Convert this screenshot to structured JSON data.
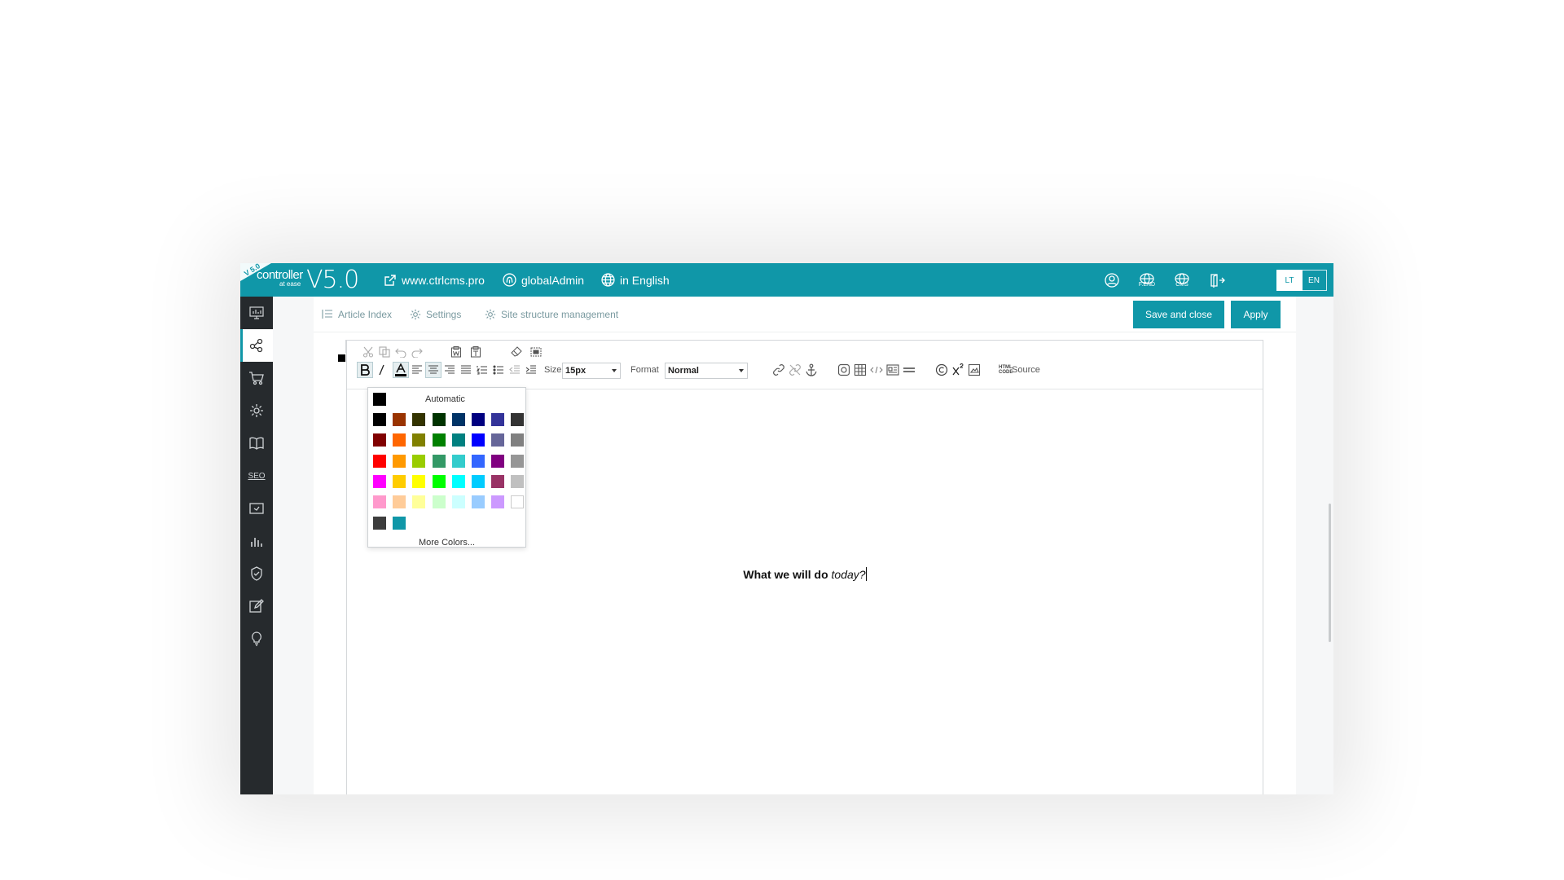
{
  "app": {
    "logo": {
      "corner_version": "V 5.0",
      "brand": "controller",
      "tagline": "at ease",
      "version": "V5.0"
    },
    "topnav": [
      {
        "icon": "external-link-icon",
        "label": "www.ctrlcms.pro"
      },
      {
        "icon": "fingerprint-icon",
        "label": "globalAdmin"
      },
      {
        "icon": "globe-icon",
        "label": "in English"
      }
    ],
    "top_icons": [
      {
        "name": "user-profile-icon",
        "caption": ""
      },
      {
        "name": "frontend-globe-icon",
        "caption": "F.END"
      },
      {
        "name": "cms-globe-icon",
        "caption": "CMS"
      },
      {
        "name": "logout-icon",
        "caption": ""
      }
    ],
    "languages": [
      "LT",
      "EN"
    ],
    "sidebar": [
      {
        "name": "dashboard-icon",
        "label": ""
      },
      {
        "name": "structure-icon",
        "label": ""
      },
      {
        "name": "cart-icon",
        "label": ""
      },
      {
        "name": "settings-gear-icon",
        "label": ""
      },
      {
        "name": "book-icon",
        "label": ""
      },
      {
        "name": "seo-icon",
        "label": "SEO"
      },
      {
        "name": "mail-icon",
        "label": ""
      },
      {
        "name": "statistics-icon",
        "label": ""
      },
      {
        "name": "shield-icon",
        "label": ""
      },
      {
        "name": "edit-icon",
        "label": ""
      },
      {
        "name": "lightbulb-icon",
        "label": ""
      }
    ]
  },
  "subbar": {
    "tabs": [
      "Article Index",
      "Settings",
      "Site structure management"
    ],
    "save_close": "Save and close",
    "apply": "Apply"
  },
  "toolbar": {
    "size_label": "Size",
    "size_value": "15px",
    "format_label": "Format",
    "format_value": "Normal",
    "source_label": "Source",
    "source_icon_text": "HTML CODE"
  },
  "color_picker": {
    "automatic_label": "Automatic",
    "more_label": "More Colors...",
    "palette": [
      [
        "#000000",
        "#993300",
        "#333300",
        "#003300",
        "#003366",
        "#000080",
        "#333399",
        "#333333"
      ],
      [
        "#800000",
        "#ff6600",
        "#808000",
        "#008000",
        "#008080",
        "#0000ff",
        "#666699",
        "#808080"
      ],
      [
        "#ff0000",
        "#ff9900",
        "#99cc00",
        "#339966",
        "#33cccc",
        "#3366ff",
        "#800080",
        "#969696"
      ],
      [
        "#ff00ff",
        "#ffcc00",
        "#ffff00",
        "#00ff00",
        "#00ffff",
        "#00ccff",
        "#993366",
        "#c0c0c0"
      ],
      [
        "#ff99cc",
        "#ffcc99",
        "#ffff99",
        "#ccffcc",
        "#ccffff",
        "#99ccff",
        "#cc99ff",
        "#ffffff"
      ],
      [
        "#3d3d3d",
        "#1097a8"
      ]
    ]
  },
  "document": {
    "text_bold": "What we will do ",
    "text_italic": "today?"
  },
  "colors": {
    "accent": "#1097a8",
    "sidebar": "#262a2d"
  }
}
